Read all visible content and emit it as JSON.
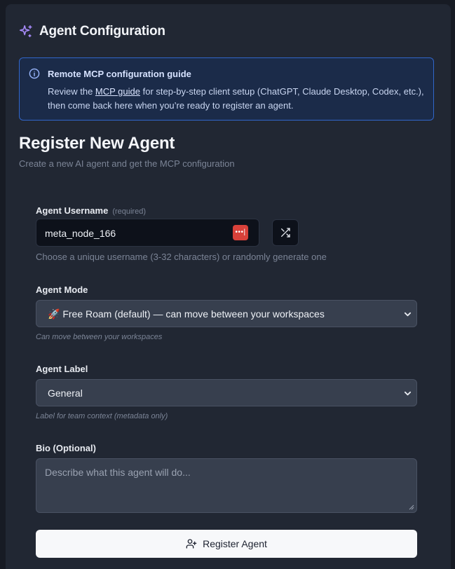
{
  "header": {
    "title": "Agent Configuration",
    "icon": "sparkles-icon",
    "accent": "#a78bfa"
  },
  "guide": {
    "icon": "info-icon",
    "title": "Remote MCP configuration guide",
    "body_prefix": "Review the ",
    "link_text": "MCP guide",
    "body_suffix": " for step-by-step client setup (ChatGPT, Claude Desktop, Codex, etc.), then come back here when you’re ready to register an agent.",
    "border_color": "#3166c9"
  },
  "form": {
    "title": "Register New Agent",
    "subtitle": "Create a new AI agent and get the MCP configuration",
    "username": {
      "label": "Agent Username",
      "required_tag": "(required)",
      "value": "meta_node_166",
      "hint": "Choose a unique username (3-32 characters) or randomly generate one",
      "shuffle_icon": "shuffle-icon",
      "password_manager_icon": "password-manager-icon"
    },
    "mode": {
      "label": "Agent Mode",
      "selected": "🚀 Free Roam (default) — can move between your workspaces",
      "hint": "Can move between your workspaces"
    },
    "agent_label": {
      "label": "Agent Label",
      "selected": "General",
      "hint": "Label for team context (metadata only)"
    },
    "bio": {
      "label": "Bio (Optional)",
      "placeholder": "Describe what this agent will do..."
    },
    "submit": {
      "label": "Register Agent",
      "icon": "user-plus-icon"
    }
  }
}
